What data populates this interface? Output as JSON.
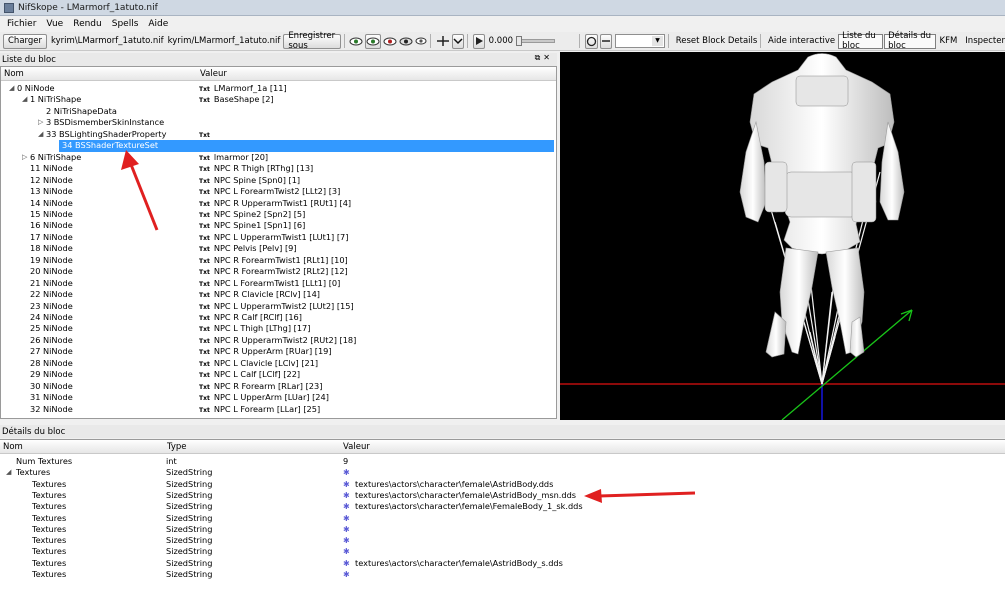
{
  "window": {
    "title": "NifSkope - LMarmorf_1atuto.nif"
  },
  "menu": [
    "Fichier",
    "Vue",
    "Rendu",
    "Spells",
    "Aide"
  ],
  "toolbar": {
    "load_label": "Charger",
    "path_left": "kyrim\\LMarmorf_1atuto.nif",
    "path_right": "kyrim/LMarmorf_1atuto.nif",
    "save_label": "Enregistrer sous",
    "time_value": "0.000",
    "reset_label": "Reset Block Details",
    "help_label": "Aide interactive",
    "tab_list": "Liste du bloc",
    "tab_details": "Détails du bloc",
    "kfm_label": "KFM",
    "inspect_label": "Inspecter"
  },
  "block_list": {
    "title": "Liste du bloc",
    "col_name": "Nom",
    "col_value": "Valeur",
    "txt_badge": "Txt",
    "rows": [
      {
        "name": "0 NiNode",
        "value": "LMarmorf_1a [11]",
        "txt": true,
        "indent": 0,
        "exp": "◢"
      },
      {
        "name": "1 NiTriShape",
        "value": "BaseShape [2]",
        "txt": true,
        "indent": 1,
        "exp": "◢"
      },
      {
        "name": "2 NiTriShapeData",
        "value": "",
        "txt": false,
        "indent": 2,
        "exp": ""
      },
      {
        "name": "3 BSDismemberSkinInstance",
        "value": "",
        "txt": false,
        "indent": 2,
        "exp": "▷"
      },
      {
        "name": "33 BSLightingShaderProperty",
        "value": "",
        "txt": true,
        "indent": 2,
        "exp": "◢"
      },
      {
        "name": "34 BSShaderTextureSet",
        "value": "",
        "txt": false,
        "indent": 3,
        "exp": "",
        "selected": true
      },
      {
        "name": "6 NiTriShape",
        "value": "lmarmor [20]",
        "txt": true,
        "indent": 1,
        "exp": "▷"
      },
      {
        "name": "11 NiNode",
        "value": "NPC R Thigh [RThg] [13]",
        "txt": true,
        "indent": 1,
        "exp": ""
      },
      {
        "name": "12 NiNode",
        "value": "NPC Spine [Spn0] [1]",
        "txt": true,
        "indent": 1,
        "exp": ""
      },
      {
        "name": "13 NiNode",
        "value": "NPC L ForearmTwist2 [LLt2] [3]",
        "txt": true,
        "indent": 1,
        "exp": ""
      },
      {
        "name": "14 NiNode",
        "value": "NPC R UpperarmTwist1 [RUt1] [4]",
        "txt": true,
        "indent": 1,
        "exp": ""
      },
      {
        "name": "15 NiNode",
        "value": "NPC Spine2 [Spn2] [5]",
        "txt": true,
        "indent": 1,
        "exp": ""
      },
      {
        "name": "16 NiNode",
        "value": "NPC Spine1 [Spn1] [6]",
        "txt": true,
        "indent": 1,
        "exp": ""
      },
      {
        "name": "17 NiNode",
        "value": "NPC L UpperarmTwist1 [LUt1] [7]",
        "txt": true,
        "indent": 1,
        "exp": ""
      },
      {
        "name": "18 NiNode",
        "value": "NPC Pelvis [Pelv] [9]",
        "txt": true,
        "indent": 1,
        "exp": ""
      },
      {
        "name": "19 NiNode",
        "value": "NPC R ForearmTwist1 [RLt1] [10]",
        "txt": true,
        "indent": 1,
        "exp": ""
      },
      {
        "name": "20 NiNode",
        "value": "NPC R ForearmTwist2 [RLt2] [12]",
        "txt": true,
        "indent": 1,
        "exp": ""
      },
      {
        "name": "21 NiNode",
        "value": "NPC L ForearmTwist1 [LLt1] [0]",
        "txt": true,
        "indent": 1,
        "exp": ""
      },
      {
        "name": "22 NiNode",
        "value": "NPC R Clavicle [RClv] [14]",
        "txt": true,
        "indent": 1,
        "exp": ""
      },
      {
        "name": "23 NiNode",
        "value": "NPC L UpperarmTwist2 [LUt2] [15]",
        "txt": true,
        "indent": 1,
        "exp": ""
      },
      {
        "name": "24 NiNode",
        "value": "NPC R Calf [RClf] [16]",
        "txt": true,
        "indent": 1,
        "exp": ""
      },
      {
        "name": "25 NiNode",
        "value": "NPC L Thigh [LThg] [17]",
        "txt": true,
        "indent": 1,
        "exp": ""
      },
      {
        "name": "26 NiNode",
        "value": "NPC R UpperarmTwist2 [RUt2] [18]",
        "txt": true,
        "indent": 1,
        "exp": ""
      },
      {
        "name": "27 NiNode",
        "value": "NPC R UpperArm [RUar] [19]",
        "txt": true,
        "indent": 1,
        "exp": ""
      },
      {
        "name": "28 NiNode",
        "value": "NPC L Clavicle [LClv] [21]",
        "txt": true,
        "indent": 1,
        "exp": ""
      },
      {
        "name": "29 NiNode",
        "value": "NPC L Calf [LClf] [22]",
        "txt": true,
        "indent": 1,
        "exp": ""
      },
      {
        "name": "30 NiNode",
        "value": "NPC R Forearm [RLar] [23]",
        "txt": true,
        "indent": 1,
        "exp": ""
      },
      {
        "name": "31 NiNode",
        "value": "NPC L UpperArm [LUar] [24]",
        "txt": true,
        "indent": 1,
        "exp": ""
      },
      {
        "name": "32 NiNode",
        "value": "NPC L Forearm [LLar] [25]",
        "txt": true,
        "indent": 1,
        "exp": ""
      }
    ]
  },
  "details": {
    "title": "Détails du bloc",
    "col_name": "Nom",
    "col_type": "Type",
    "col_value": "Valeur",
    "rows": [
      {
        "name": "Num Textures",
        "type": "int",
        "value": "9",
        "icon": false,
        "indent": 1,
        "exp": ""
      },
      {
        "name": "Textures",
        "type": "SizedString",
        "value": "",
        "icon": true,
        "indent": 1,
        "exp": "◢"
      },
      {
        "name": "Textures",
        "type": "SizedString",
        "value": "textures\\actors\\character\\female\\AstridBody.dds",
        "icon": true,
        "indent": 2,
        "exp": ""
      },
      {
        "name": "Textures",
        "type": "SizedString",
        "value": "textures\\actors\\character\\female\\AstridBody_msn.dds",
        "icon": true,
        "indent": 2,
        "exp": ""
      },
      {
        "name": "Textures",
        "type": "SizedString",
        "value": "textures\\actors\\character\\female\\FemaleBody_1_sk.dds",
        "icon": true,
        "indent": 2,
        "exp": ""
      },
      {
        "name": "Textures",
        "type": "SizedString",
        "value": "",
        "icon": true,
        "indent": 2,
        "exp": ""
      },
      {
        "name": "Textures",
        "type": "SizedString",
        "value": "",
        "icon": true,
        "indent": 2,
        "exp": ""
      },
      {
        "name": "Textures",
        "type": "SizedString",
        "value": "",
        "icon": true,
        "indent": 2,
        "exp": ""
      },
      {
        "name": "Textures",
        "type": "SizedString",
        "value": "",
        "icon": true,
        "indent": 2,
        "exp": ""
      },
      {
        "name": "Textures",
        "type": "SizedString",
        "value": "textures\\actors\\character\\female\\AstridBody_s.dds",
        "icon": true,
        "indent": 2,
        "exp": ""
      },
      {
        "name": "Textures",
        "type": "SizedString",
        "value": "",
        "icon": true,
        "indent": 2,
        "exp": ""
      }
    ]
  },
  "colors": {
    "selection": "#3399ff",
    "annotation_arrow": "#e02020",
    "viewport_bg": "#000000"
  },
  "icons": {
    "texture_value": "asterisk-icon"
  }
}
